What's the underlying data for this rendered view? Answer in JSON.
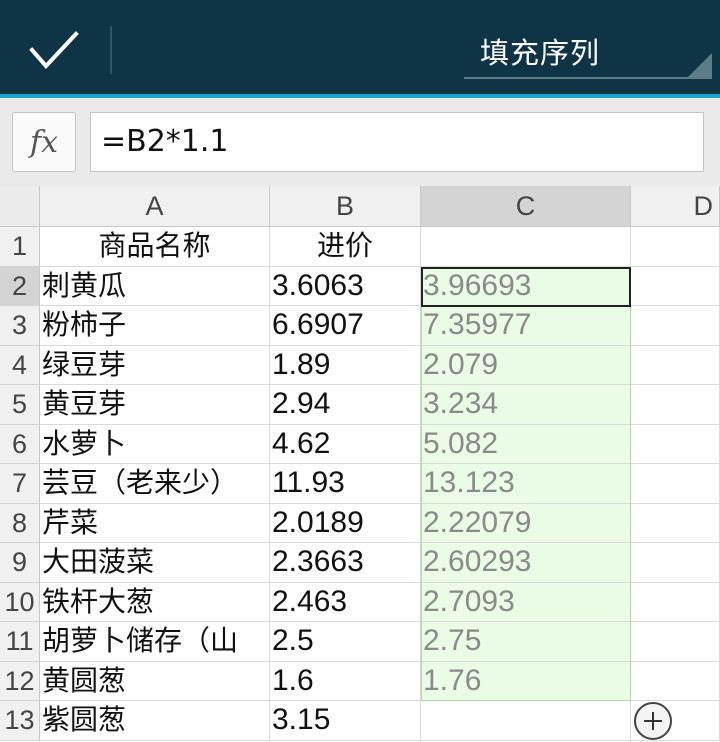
{
  "toolbar": {
    "confirm_icon": "check-icon",
    "mode_label": "填充序列"
  },
  "formula_bar": {
    "fx_label": "fx",
    "formula": "=B2*1.1"
  },
  "columns": [
    "A",
    "B",
    "C",
    "D"
  ],
  "rows": [
    {
      "num": "1",
      "a": "商品名称",
      "b": "进价",
      "c": ""
    },
    {
      "num": "2",
      "a": "刺黄瓜",
      "b": "3.6063",
      "c": "3.96693"
    },
    {
      "num": "3",
      "a": "粉柿子",
      "b": "6.6907",
      "c": "7.35977"
    },
    {
      "num": "4",
      "a": "绿豆芽",
      "b": "1.89",
      "c": "2.079"
    },
    {
      "num": "5",
      "a": "黄豆芽",
      "b": "2.94",
      "c": "3.234"
    },
    {
      "num": "6",
      "a": "水萝卜",
      "b": "4.62",
      "c": "5.082"
    },
    {
      "num": "7",
      "a": "芸豆（老来少）",
      "b": "11.93",
      "c": "13.123"
    },
    {
      "num": "8",
      "a": "芹菜",
      "b": "2.0189",
      "c": "2.22079"
    },
    {
      "num": "9",
      "a": "大田菠菜",
      "b": "2.3663",
      "c": "2.60293"
    },
    {
      "num": "10",
      "a": "铁杆大葱",
      "b": "2.463",
      "c": "2.7093"
    },
    {
      "num": "11",
      "a": "胡萝卜储存（山",
      "b": "2.5",
      "c": "2.75"
    },
    {
      "num": "12",
      "a": "黄圆葱",
      "b": "1.6",
      "c": "1.76"
    },
    {
      "num": "13",
      "a": "紫圆葱",
      "b": "3.15",
      "c": ""
    }
  ],
  "colors": {
    "toolbar_bg": "#0f3446",
    "accent": "#1aa6cc",
    "fill_bg": "#eafbe6",
    "fill_border": "#a8e09a"
  }
}
